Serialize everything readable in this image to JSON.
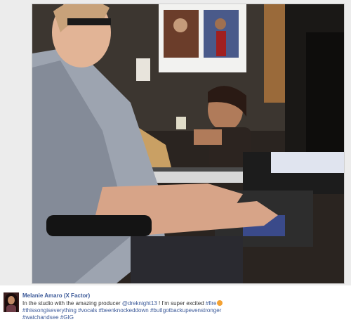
{
  "post": {
    "author": "Melanie Amaro (X Factor)",
    "text_before": "In the studio with the amazing producer ",
    "mention": "@dreknight13",
    "text_middle": " ! I'm super excited ",
    "hashtag_fire": "#fire",
    "emoji_icon": "fire-emoji",
    "hashtags": [
      "#thissongiseverything",
      "#vocals",
      "#beenknockeddown",
      "#butIgotbackupevenstronger",
      "#watchandsee",
      "#GIG"
    ]
  },
  "colors": {
    "link": "#3b5998",
    "text": "#333333"
  }
}
